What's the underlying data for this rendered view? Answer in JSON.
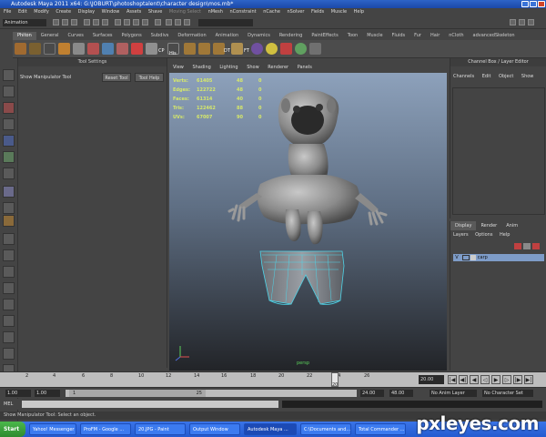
{
  "window": {
    "title": "Autodesk Maya 2011 x64: G:\\JOBURT\\photoshoptalent\\character design\\mos.mb*"
  },
  "menubar": [
    "File",
    "Edit",
    "Modify",
    "Create",
    "Display",
    "Window",
    "Assets",
    "Shave",
    "Moving Select",
    "nMesh",
    "nConstraint",
    "nCache",
    "nSolver",
    "Fields",
    "Muscle",
    "Help"
  ],
  "statusline": {
    "mode": "Animation"
  },
  "shelf": {
    "tabs": [
      "Phiton",
      "General",
      "Curves",
      "Surfaces",
      "Polygons",
      "Subdivs",
      "Deformation",
      "Animation",
      "Dynamics",
      "Rendering",
      "PaintEffects",
      "Toon",
      "Muscle",
      "Fluids",
      "Fur",
      "Hair",
      "nCloth",
      "advancedSkeleton"
    ],
    "active_tab": "Phiton",
    "icon_labels": [
      "CP",
      "His",
      "DT",
      "FT"
    ]
  },
  "tool_settings": {
    "header": "Tool Settings",
    "tool_name": "Show Manipulator Tool",
    "reset_button": "Reset Tool",
    "help_button": "Tool Help"
  },
  "viewport": {
    "menu": [
      "View",
      "Shading",
      "Lighting",
      "Show",
      "Renderer",
      "Panels"
    ],
    "hud": [
      {
        "label": "Verts:",
        "v1": "61405",
        "v2": "48",
        "v3": "0"
      },
      {
        "label": "Edges:",
        "v1": "122722",
        "v2": "48",
        "v3": "0"
      },
      {
        "label": "Faces:",
        "v1": "61314",
        "v2": "40",
        "v3": "0"
      },
      {
        "label": "Tris:",
        "v1": "122462",
        "v2": "88",
        "v3": "0"
      },
      {
        "label": "UVs:",
        "v1": "67007",
        "v2": "90",
        "v3": "0"
      }
    ],
    "camera_label": "persp"
  },
  "channel_box": {
    "header": "Channel Box / Layer Editor",
    "menu": [
      "Channels",
      "Edit",
      "Object",
      "Show"
    ]
  },
  "layer_editor": {
    "tabs": [
      "Display",
      "Render",
      "Anim"
    ],
    "active_tab": "Display",
    "menu": [
      "Layers",
      "Options",
      "Help"
    ],
    "layer_visible": "V",
    "layer_name": "carp"
  },
  "timeline": {
    "ticks": [
      "2",
      "4",
      "6",
      "8",
      "10",
      "12",
      "14",
      "16",
      "18",
      "20",
      "22",
      "24",
      "26"
    ],
    "current_frame": "20.00",
    "current_marker": "20"
  },
  "range": {
    "start_time": "1.00",
    "start_playback": "1.00",
    "range_left": "1",
    "range_right": "25",
    "end_playback": "24.00",
    "end_time": "48.00",
    "anim_layer": "No Anim Layer",
    "character_set": "No Character Set"
  },
  "mel": {
    "label": "MEL"
  },
  "helpline": {
    "text": "Show Manipulator Tool: Select an object."
  },
  "taskbar": {
    "start": "Start",
    "tasks": [
      "Yahoo! Messenger",
      "ProFM - Google ...",
      "20.JPG - Paint",
      "Output Window",
      "Autodesk Maya ...",
      "C:\\Documents and...",
      "Total Commander ..."
    ],
    "active_task": "Autodesk Maya ..."
  },
  "watermark": "pxleyes.com",
  "colors": {
    "title_bar": "#1b48a8",
    "panel_bg": "#444444",
    "viewport_top": "#8da1bb",
    "viewport_bottom": "#222428",
    "hud_text": "#d6e86a",
    "selected_layer": "#7e9cc8",
    "selection_wire": "#4fd4e8"
  }
}
